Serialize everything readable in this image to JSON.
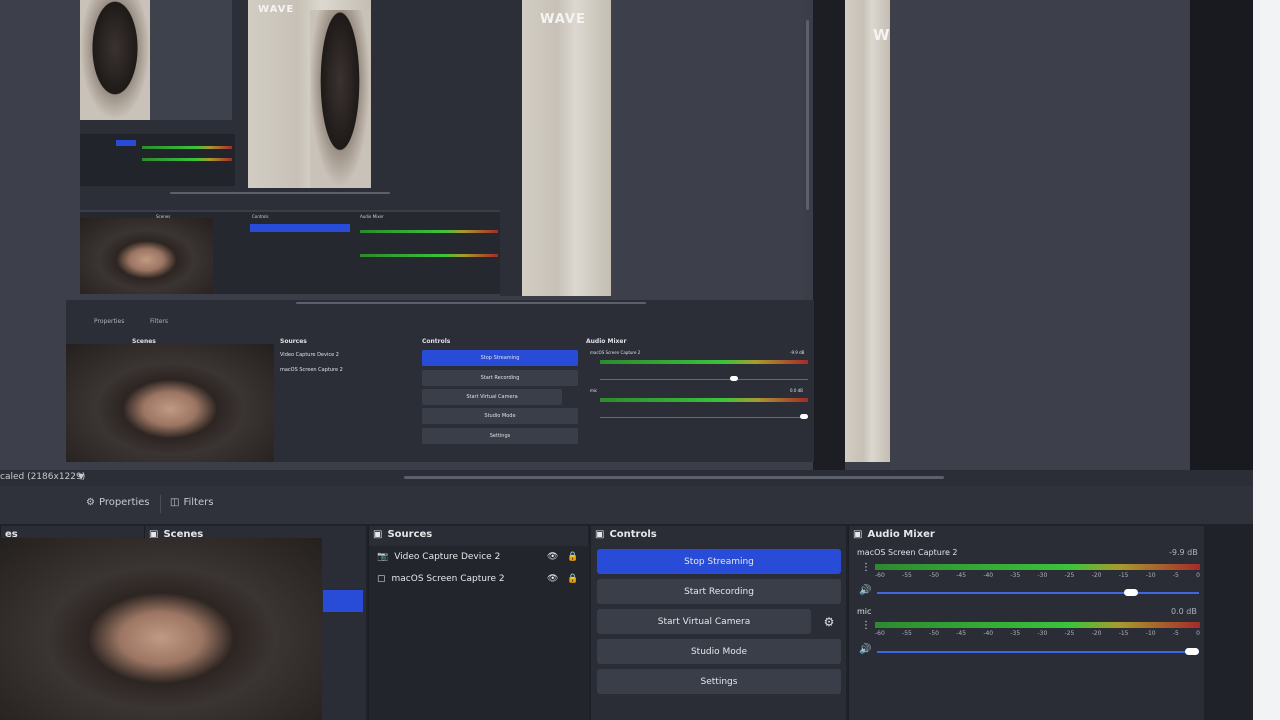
{
  "preview": {
    "watermark": "WAVE",
    "watermark_cut": "W",
    "nested_properties": "Properties",
    "nested_filters": "Filters",
    "nested_scenes": "Scenes",
    "nested_sources": "Sources",
    "nested_controls": "Controls",
    "nested_audio_mixer": "Audio Mixer",
    "nested_sources_list": [
      "Video Capture Device 2",
      "macOS Screen Capture 2"
    ],
    "nested_controls_list": [
      "Stop Streaming",
      "Start Recording",
      "Start Virtual Camera",
      "Studio Mode",
      "Settings"
    ],
    "nested_mixer_tracks": [
      {
        "name": "macOS Screen Capture 2",
        "db": "-9.9 dB"
      },
      {
        "name": "mic",
        "db": "0.0 dB"
      }
    ]
  },
  "statusbar": {
    "scale_text": "caled (2186x1229)"
  },
  "toolbar": {
    "properties_label": "Properties",
    "filters_label": "Filters"
  },
  "scenes": {
    "title": "Scenes",
    "left_fragment": "es"
  },
  "sources": {
    "title": "Sources",
    "items": [
      {
        "label": "Video Capture Device 2",
        "icon": "camera-icon"
      },
      {
        "label": "macOS Screen Capture 2",
        "icon": "monitor-icon"
      }
    ]
  },
  "controls": {
    "title": "Controls",
    "stop_streaming": "Stop Streaming",
    "start_recording": "Start Recording",
    "start_virtual_camera": "Start Virtual Camera",
    "studio_mode": "Studio Mode",
    "settings": "Settings"
  },
  "audio_mixer": {
    "title": "Audio Mixer",
    "scale_labels": [
      "-60",
      "-55",
      "-50",
      "-45",
      "-40",
      "-35",
      "-30",
      "-25",
      "-20",
      "-15",
      "-10",
      "-5",
      "0"
    ],
    "tracks": [
      {
        "name": "macOS Screen Capture 2",
        "db": "-9.9 dB",
        "volume": 0.79
      },
      {
        "name": "mic",
        "db": "0.0 dB",
        "volume": 1.0
      }
    ]
  },
  "colors": {
    "accent": "#284cd8",
    "dock_bg": "#2a2d36",
    "preview_bg": "#3b3e48"
  }
}
